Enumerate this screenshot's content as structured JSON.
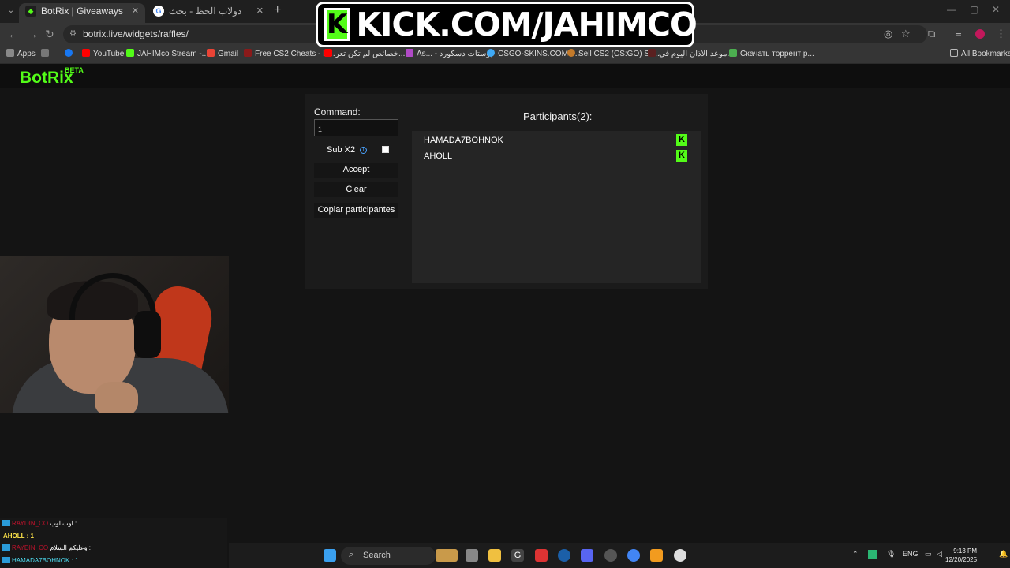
{
  "browser": {
    "tabs": [
      {
        "title": "BotRix | Giveaways",
        "active": true
      },
      {
        "title": "دولاب الحظ - بحث Google",
        "active": false
      }
    ],
    "url": "botrix.live/widgets/raffles/",
    "bookmarks": [
      "Apps",
      "YouTube",
      "JAHIMco Stream -...",
      "Gmail",
      "Free CS2 Cheats - D...",
      "خصائص لم تكن تعر...",
      "As... - بوستات دسكورد",
      "CSGO-SKINS.COM -...",
      "Sell CS2 (CS:GO) Ski...",
      "موعد الاذان اليوم في...",
      "Скачать торрент р..."
    ],
    "all_bookmarks": "All Bookmarks"
  },
  "overlay": {
    "kick_text": "KICK.COM/JAHIMCO",
    "kick_logo": "K"
  },
  "app": {
    "logo": "BotRix",
    "beta": "BETA"
  },
  "raffle": {
    "command_label": "Command:",
    "command_value": "1",
    "sub_label": "Sub X2",
    "sub_checked": false,
    "accept": "Accept",
    "clear": "Clear",
    "copy": "Copiar participantes",
    "participants_title": "Participants(2):",
    "participants": [
      "HAMADA7BOHNOK",
      "AHOLL"
    ]
  },
  "chat": [
    {
      "user": "RAYDIN_CO",
      "msg": "اوب اوب :"
    },
    {
      "user": "",
      "msg": "AHOLL : 1"
    },
    {
      "user": "RAYDIN_CO",
      "msg": "وعليكم السلام :"
    },
    {
      "user": "",
      "msg": "HAMADA7BOHNOK : 1"
    }
  ],
  "taskbar": {
    "search": "Search",
    "lang": "ENG",
    "time": "9:13 PM",
    "date": "12/20/2025"
  },
  "colors": {
    "kick_green": "#53fc18",
    "panel": "#1b1b1b"
  }
}
